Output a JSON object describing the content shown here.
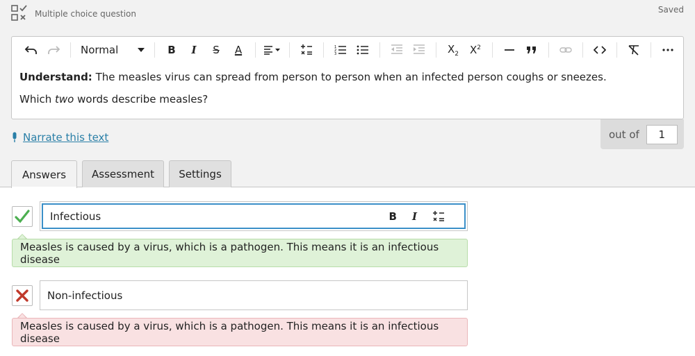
{
  "header": {
    "question_type": "Multiple choice question",
    "status": "Saved"
  },
  "toolbar": {
    "format_select": "Normal"
  },
  "editor": {
    "line1_bold": "Understand:",
    "line1_rest": " The measles virus can spread from person to person when an infected person coughs or sneezes.",
    "line2_pre": "Which ",
    "line2_em": "two",
    "line2_post": " words describe measles?"
  },
  "narrate": {
    "label": "Narrate this text"
  },
  "score": {
    "label": "out of",
    "value": "1"
  },
  "tabs": [
    {
      "label": "Answers",
      "active": true
    },
    {
      "label": "Assessment",
      "active": false
    },
    {
      "label": "Settings",
      "active": false
    }
  ],
  "answers": [
    {
      "text": "Infectious",
      "correct": true,
      "feedback": "Measles is caused by a virus, which is a pathogen. This means it is an infectious disease"
    },
    {
      "text": "Non-infectious",
      "correct": false,
      "feedback": "Measles is caused by a virus, which is a pathogen. This means it is an infectious disease"
    }
  ],
  "colors": {
    "correct": "#4caf50",
    "incorrect": "#c0392b",
    "link": "#2a7fa7",
    "focus": "#3a8fc8"
  }
}
